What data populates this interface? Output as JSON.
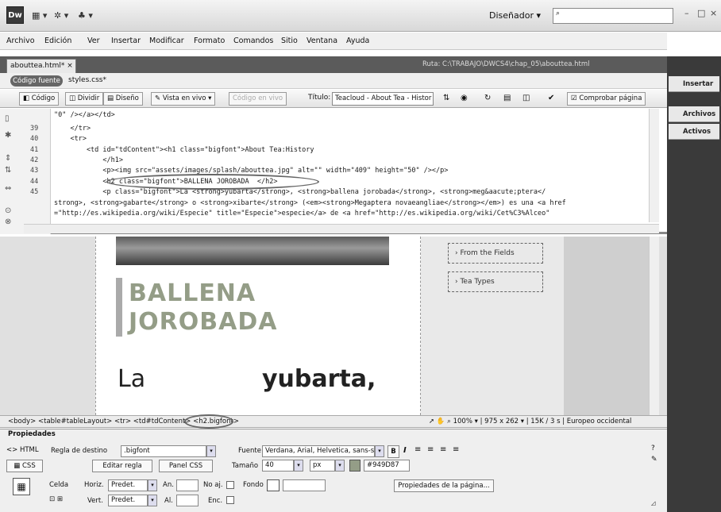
{
  "app": {
    "logo": "Dw",
    "workspace": "Diseñador",
    "window_controls": [
      "–",
      "□",
      "×"
    ]
  },
  "menu": [
    "Archivo",
    "Edición",
    "Ver",
    "Insertar",
    "Modificar",
    "Formato",
    "Comandos",
    "Sitio",
    "Ventana",
    "Ayuda"
  ],
  "document": {
    "tab": "abouttea.html*",
    "path_label": "Ruta:",
    "path": "C:\\TRABAJO\\DWCS4\\chap_05\\abouttea.html",
    "related_source": "Código fuente",
    "related_css": "styles.css*"
  },
  "doc_toolbar": {
    "code": "Código",
    "split": "Dividir",
    "design": "Diseño",
    "live_view": "Vista en vivo",
    "live_code": "Código en vivo",
    "title_label": "Título:",
    "title_value": "Teacloud - About Tea - Histor",
    "check_page": "Comprobar página"
  },
  "code": {
    "lines": [
      {
        "num": "",
        "text": "\"0\" /></a></td>"
      },
      {
        "num": "39",
        "text": "    </tr>"
      },
      {
        "num": "40",
        "text": "    <tr>"
      },
      {
        "num": "41",
        "text": "        <td id=\"tdContent\"><h1 class=\"bigfont\">About Tea:History"
      },
      {
        "num": "42",
        "text": "            </h1>"
      },
      {
        "num": "43",
        "text": "            <p><img src=\"assets/images/splash/abouttea.jpg\" alt=\"\" width=\"409\" height=\"50\" /></p>"
      },
      {
        "num": "44",
        "text": "            <h2 class=\"bigfont\">BALLENA JOROBADA  </h2>"
      },
      {
        "num": "45",
        "text": "            <p class=\"bigfont\">La <strong>yubarta</strong>, <strong>ballena jorobada</strong>, <strong>meg&aacute;ptera</"
      },
      {
        "num": "",
        "text": "strong>, <strong>gabarte</strong> o <strong>xibarte</strong> (<em><strong>Megaptera novaeangliae</strong></em>) es una <a href"
      },
      {
        "num": "",
        "text": "=\"http://es.wikipedia.org/wiki/Especie\" title=\"Especie\">especie</a> de <a href=\"http://es.wikipedia.org/wiki/Cet%C3%Alceo\""
      }
    ]
  },
  "design": {
    "heading_line1": "BALLENA",
    "heading_line2": "JOROBADA",
    "para_word1": "La",
    "para_word2": "yubarta,",
    "side_links": [
      "› From the Fields",
      "› Tea Types"
    ]
  },
  "status": {
    "tags": [
      "<body>",
      "<table#tableLayout>",
      "<tr>",
      "<td#tdContent>",
      "<h2.bigfont>"
    ],
    "zoom": "100%",
    "size": "975 x 262",
    "weight": "15K / 3 s",
    "encoding": "Europeo occidental"
  },
  "properties": {
    "title": "Propiedades",
    "html_btn": "HTML",
    "css_btn": "CSS",
    "target_rule_label": "Regla de destino",
    "target_rule": ".bigfont",
    "edit_rule": "Editar regla",
    "css_panel": "Panel CSS",
    "font_label": "Fuente",
    "font_value": "Verdana, Arial, Helvetica, sans-se",
    "size_label": "Tamaño",
    "size_value": "40",
    "unit_value": "px",
    "color_value": "#949D87",
    "cell_label": "Celda",
    "horiz_label": "Horiz.",
    "horiz_value": "Predet.",
    "vert_label": "Vert.",
    "vert_value": "Predet.",
    "width_label": "An.",
    "height_label": "Al.",
    "nowrap_label": "No aj.",
    "header_label": "Enc.",
    "bg_label": "Fondo",
    "page_props": "Propiedades de la página..."
  },
  "right_panel": [
    "Insertar",
    "Archivos",
    "Activos"
  ],
  "colors": {
    "heading": "#949d87"
  }
}
